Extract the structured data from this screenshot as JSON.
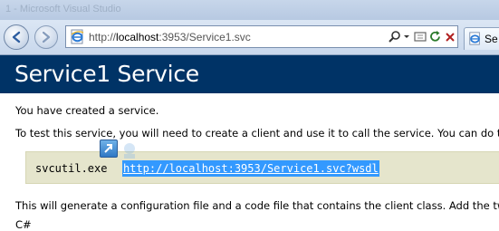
{
  "window": {
    "title": "1 - Microsoft Visual Studio"
  },
  "toolbar": {
    "url_prefix": "http://",
    "url_host": "localhost",
    "url_rest": ":3953/Service1.svc",
    "tab_label": "Se"
  },
  "page": {
    "title": "Service1 Service",
    "p1": "You have created a service.",
    "p2": "To test this service, you will need to create a client and use it to call the service. You can do t",
    "code_command": "svcutil.exe",
    "code_link": "http://localhost:3953/Service1.svc?wsdl",
    "p3": "This will generate a configuration file and a code file that contains the client class. Add the tw",
    "p4": "C#"
  },
  "colors": {
    "header_bg": "#003366",
    "code_bg": "#e5e5cc",
    "link_highlight": "#3399ff"
  },
  "icons": [
    "back-icon",
    "forward-icon",
    "ie-page-icon",
    "search-icon",
    "dropdown-icon",
    "refresh-icon",
    "stop-icon",
    "drag-link-icon"
  ]
}
